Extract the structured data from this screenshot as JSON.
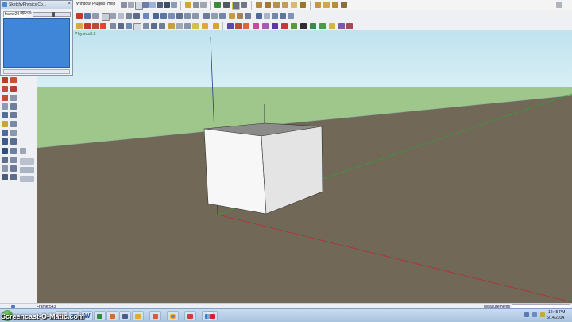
{
  "menu": {
    "items": [
      "Window",
      "Plugins",
      "Help"
    ]
  },
  "physics_panel": {
    "title": "SketchyPhysics Co...",
    "frame_field": "frame2444",
    "fps_value": "8/299",
    "slider_level": 0.55
  },
  "viewport": {
    "model_info": "Physics3.2"
  },
  "status_bar": {
    "text": "Frame:543",
    "measurements_label": "Measurements"
  },
  "taskbar": {
    "apps": [
      "explorer",
      "media-player",
      "word",
      "excel",
      "powerpoint",
      "video",
      "sketchup-physics",
      "chrome",
      "sketchup",
      "network",
      "screencast"
    ],
    "time": "12:45 PM",
    "date": "5/14/2014"
  },
  "watermark": "Screencast-O-Matic.com"
}
